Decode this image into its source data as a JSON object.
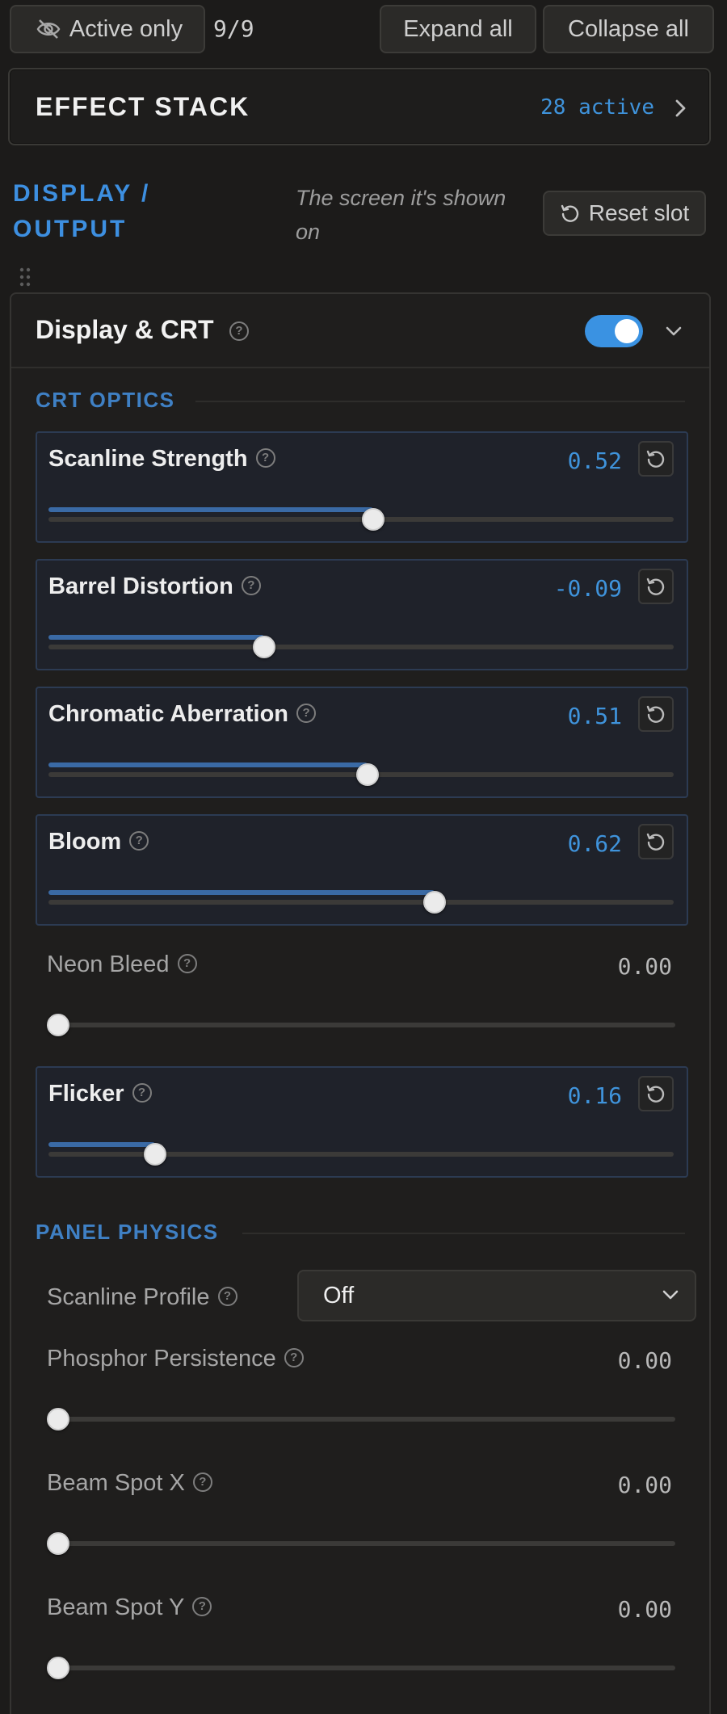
{
  "toolbar": {
    "active_only_label": "Active only",
    "count": "9/9",
    "expand_label": "Expand all",
    "collapse_label": "Collapse all"
  },
  "effect_stack": {
    "title": "EFFECT STACK",
    "active_text": "28 active"
  },
  "slot": {
    "title_line1": "DISPLAY /",
    "title_line2": "OUTPUT",
    "desc_line1": "The screen it's shown",
    "desc_line2": "on",
    "reset_label": "Reset slot"
  },
  "panel": {
    "title": "Display & CRT",
    "enabled": true,
    "help_glyph": "?"
  },
  "sections": {
    "crt_optics": "CRT OPTICS",
    "panel_physics": "PANEL PHYSICS"
  },
  "crt_params": [
    {
      "label": "Scanline Strength",
      "value": "0.52",
      "fraction": 0.52,
      "modified": true
    },
    {
      "label": "Barrel Distortion",
      "value": "-0.09",
      "fraction": 0.345,
      "modified": true
    },
    {
      "label": "Chromatic Aberration",
      "value": "0.51",
      "fraction": 0.51,
      "modified": true
    },
    {
      "label": "Bloom",
      "value": "0.62",
      "fraction": 0.617,
      "modified": true
    },
    {
      "label": "Neon Bleed",
      "value": "0.00",
      "fraction": 0.0,
      "modified": false
    },
    {
      "label": "Flicker",
      "value": "0.16",
      "fraction": 0.17,
      "modified": true
    }
  ],
  "physics": {
    "scanline_profile": {
      "label": "Scanline Profile",
      "value": "Off"
    },
    "params": [
      {
        "label": "Phosphor Persistence",
        "value": "0.00",
        "fraction": 0.0,
        "modified": false
      },
      {
        "label": "Beam Spot X",
        "value": "0.00",
        "fraction": 0.0,
        "modified": false
      },
      {
        "label": "Beam Spot Y",
        "value": "0.00",
        "fraction": 0.0,
        "modified": false
      }
    ]
  },
  "colors": {
    "accent": "#3f93db",
    "section": "#3f80c4",
    "slider_fill": "#3a6aa5",
    "background": "#1c1b1a"
  }
}
